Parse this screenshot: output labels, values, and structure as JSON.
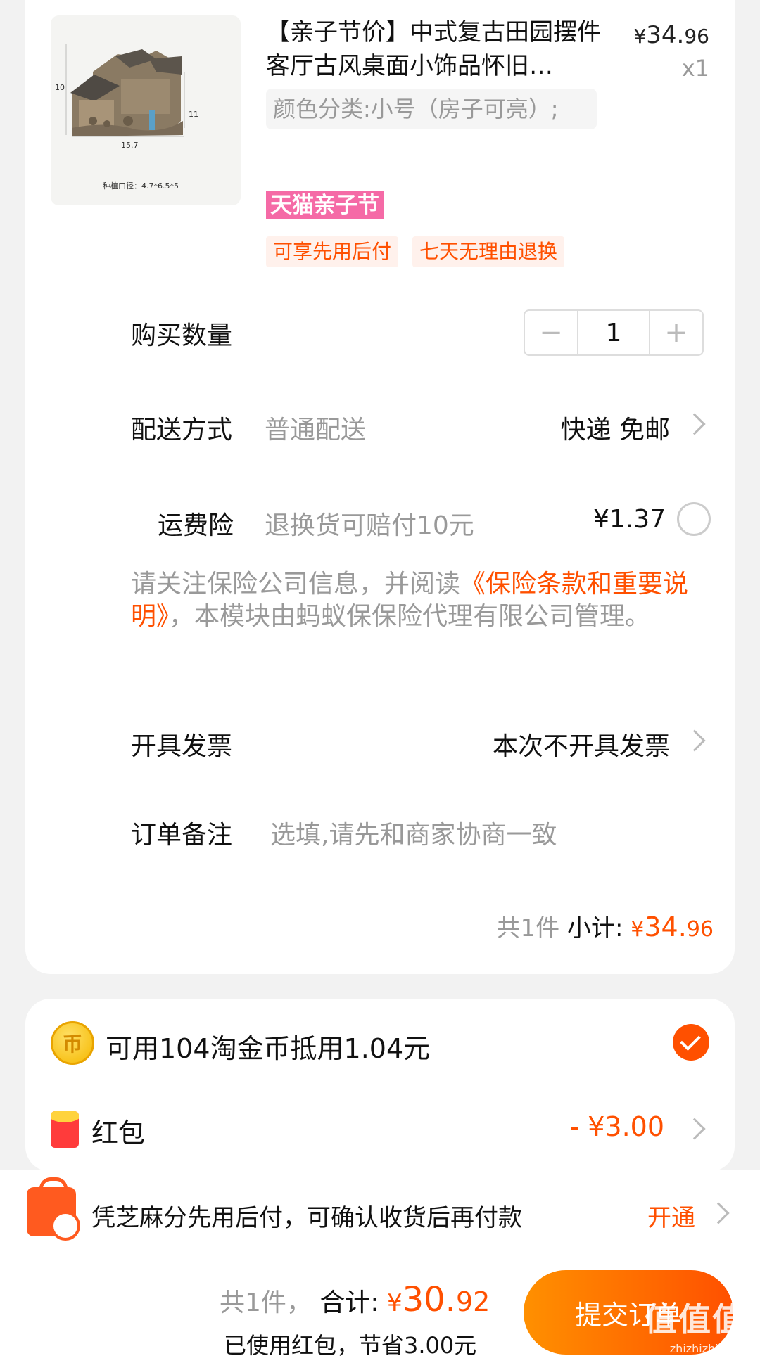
{
  "product": {
    "title": "【亲子节价】中式复古田园摆件客厅古风桌面小饰品怀旧…",
    "price_yen": "¥",
    "price_int": "34.",
    "price_dec": "96",
    "qty_label": "x1",
    "sku": "颜色分类:小号（房子可亮）;",
    "event_badge": "天猫亲子节",
    "tags": [
      "可享先用后付",
      "七天无理由退换"
    ],
    "image_dims": {
      "height": "10",
      "width": "15.7",
      "side": "11",
      "caption": "种植口径：4.7*6.5*5"
    }
  },
  "quantity": {
    "label": "购买数量",
    "minus": "−",
    "value": "1",
    "plus": "+"
  },
  "delivery": {
    "label": "配送方式",
    "value": "普通配送",
    "right": "快递 免邮"
  },
  "insurance": {
    "label": "运费险",
    "desc": "退换货可赔付10元",
    "price": "¥1.37"
  },
  "notice": {
    "pre": "请关注保险公司信息，并阅读",
    "link": "《保险条款和重要说明》",
    "post": "，本模块由蚂蚁保保险代理有限公司管理。"
  },
  "invoice": {
    "label": "开具发票",
    "value": "本次不开具发票"
  },
  "remark": {
    "label": "订单备注",
    "placeholder": "选填,请先和商家协商一致"
  },
  "subtotal": {
    "count": "共1件",
    "label": "小计:",
    "yen": "¥",
    "int": "34.",
    "dec": "96"
  },
  "coin": {
    "icon_text": "币",
    "text": "可用104淘金币抵用1.04元"
  },
  "redpacket": {
    "label": "红包",
    "value": "- ¥3.00"
  },
  "paylater": {
    "text": "凭芝麻分先用后付，可确认收货后再付款",
    "action": "开通"
  },
  "footer": {
    "count": "共1件，",
    "label": "合计:",
    "yen": "¥",
    "int": "30.",
    "dec": "92",
    "saved": "已使用红包，节省3.00元",
    "submit": "提交订单",
    "watermark": "值值值",
    "watermark_sub": "zhizhizhi.com"
  },
  "colors": {
    "accent": "#ff5000",
    "event_pink": "#f56aa6",
    "muted": "#999999"
  }
}
